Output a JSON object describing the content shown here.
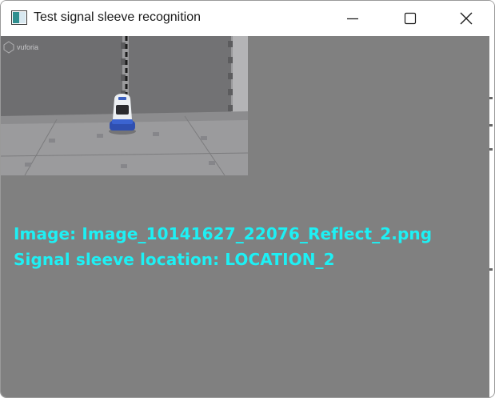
{
  "window": {
    "title": "Test signal sleeve recognition",
    "icon": "window-app-icon",
    "controls": {
      "minimize_icon": "minimize-icon",
      "maximize_icon": "maximize-icon",
      "close_icon": "close-icon"
    }
  },
  "camera": {
    "watermark": "vuforia",
    "description_icon": "robot-on-mat"
  },
  "overlay": {
    "image_line": "Image: Image_10141627_22076_Reflect_2.png",
    "location_line": "Signal sleeve location: LOCATION_2"
  },
  "colors": {
    "background": "#808080",
    "overlay_text": "#1ef0f4",
    "titlebar": "#ffffff"
  }
}
